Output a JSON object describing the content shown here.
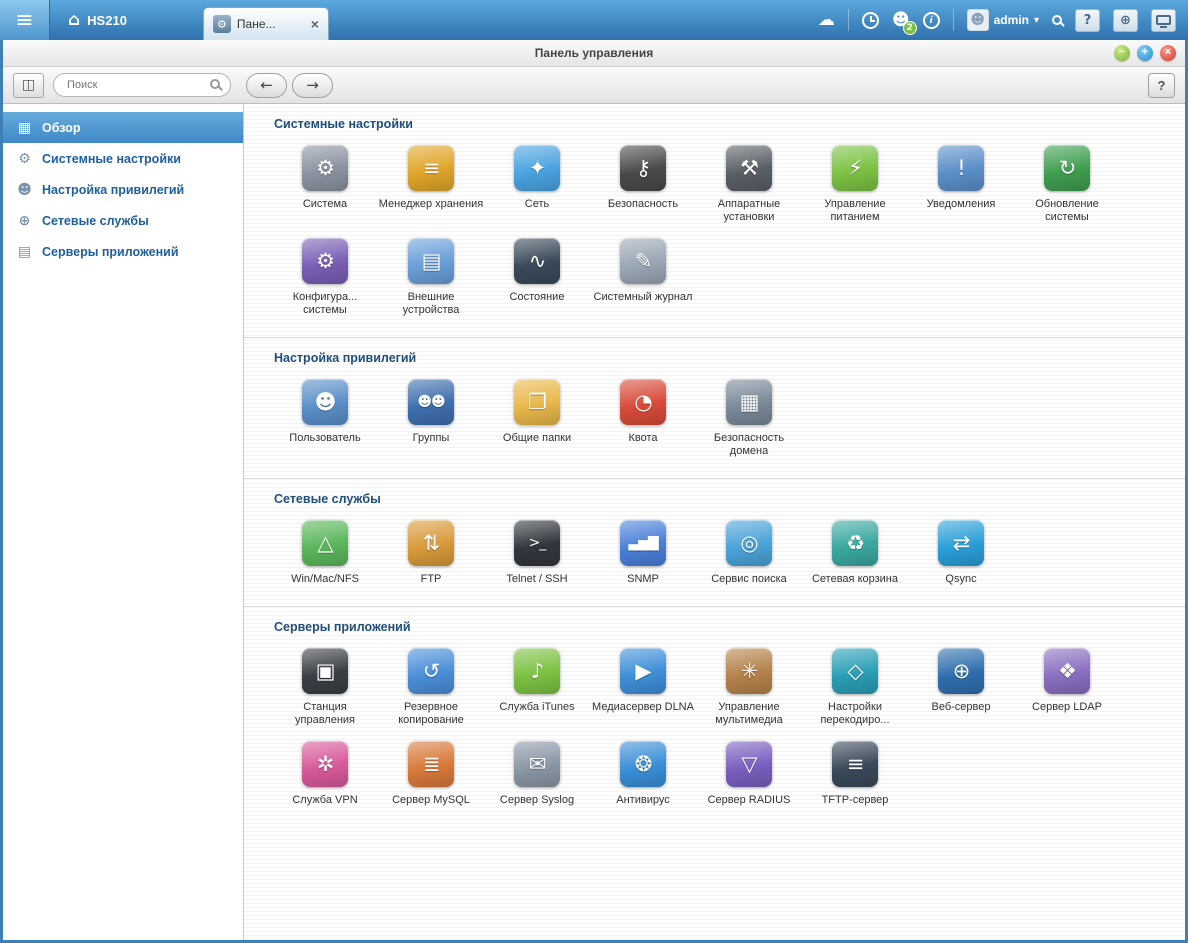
{
  "topbar": {
    "device_name": "HS210",
    "tab_label": "Пане...",
    "user_name": "admin",
    "task_badge": "2"
  },
  "window_title": "Панель управления",
  "window_controls": {
    "minimize": "−",
    "maximize": "+",
    "close": "×"
  },
  "toolbar": {
    "search_placeholder": "Поиск",
    "back_icon": "←",
    "forward_icon": "→",
    "help_label": "?"
  },
  "icons": {
    "menu": "≡",
    "home": "⌂",
    "tab_gear": "⚙",
    "tab_close": "×",
    "cloud": "☁",
    "info": "i",
    "user_silhouette": "☻",
    "caret_down": "▾",
    "sidebar_toggle": "◫",
    "globe": "⊕",
    "help": "?"
  },
  "colors": {
    "topbar_accent": "#3c86c4",
    "selected_item": "#4a94d4",
    "section_title": "#1f4e79"
  },
  "sidebar": {
    "items": [
      {
        "label": "Обзор",
        "icon": "overview-grid-icon",
        "glyph": "▦",
        "selected": true
      },
      {
        "label": "Системные настройки",
        "icon": "gear-icon",
        "glyph": "⚙",
        "selected": false
      },
      {
        "label": "Настройка привилегий",
        "icon": "user-icon",
        "glyph": "☻",
        "selected": false
      },
      {
        "label": "Сетевые службы",
        "icon": "globe-icon",
        "glyph": "⊕",
        "selected": false
      },
      {
        "label": "Серверы приложений",
        "icon": "server-icon",
        "glyph": "▤",
        "selected": false
      }
    ]
  },
  "sections": [
    {
      "title": "Системные настройки",
      "items": [
        {
          "label": "Система",
          "icon": "system-settings-icon",
          "glyph": "⚙",
          "color": "#8a93a0"
        },
        {
          "label": "Менеджер хранения",
          "icon": "storage-manager-icon",
          "glyph": "≡",
          "color": "#e0a62a"
        },
        {
          "label": "Сеть",
          "icon": "network-icon",
          "glyph": "✦",
          "color": "#4aa3e0"
        },
        {
          "label": "Безопасность",
          "icon": "security-lock-icon",
          "glyph": "⚷",
          "color": "#4a4a4a"
        },
        {
          "label": "Аппаратные установки",
          "icon": "hardware-icon",
          "glyph": "⚒",
          "color": "#5a5f66"
        },
        {
          "label": "Управление питанием",
          "icon": "power-icon",
          "glyph": "⚡",
          "color": "#7cc243"
        },
        {
          "label": "Уведомления",
          "icon": "notification-icon",
          "glyph": "!",
          "color": "#5b8fc9"
        },
        {
          "label": "Обновление системы",
          "icon": "firmware-update-icon",
          "glyph": "↻",
          "color": "#3f9e4f"
        },
        {
          "label": "Конфигура... системы",
          "icon": "system-config-icon",
          "glyph": "⚙",
          "color": "#7a5fb5"
        },
        {
          "label": "Внешние устройства",
          "icon": "external-device-icon",
          "glyph": "▤",
          "color": "#6a9fd8"
        },
        {
          "label": "Состояние",
          "icon": "system-status-icon",
          "glyph": "∿",
          "color": "#3a4a5a"
        },
        {
          "label": "Системный журнал",
          "icon": "system-logs-icon",
          "glyph": "✎",
          "color": "#9aa7b5"
        }
      ]
    },
    {
      "title": "Настройка привилегий",
      "items": [
        {
          "label": "Пользователь",
          "icon": "user-icon",
          "glyph": "☻",
          "color": "#5b8fc9"
        },
        {
          "label": "Группы",
          "icon": "user-group-icon",
          "glyph": "☻☻",
          "color": "#3f6fae"
        },
        {
          "label": "Общие папки",
          "icon": "shared-folder-icon",
          "glyph": "❐",
          "color": "#e8b84a"
        },
        {
          "label": "Квота",
          "icon": "quota-pie-icon",
          "glyph": "◔",
          "color": "#d84b3a"
        },
        {
          "label": "Безопасность домена",
          "icon": "domain-security-icon",
          "glyph": "▦",
          "color": "#7a8a99"
        }
      ]
    },
    {
      "title": "Сетевые службы",
      "items": [
        {
          "label": "Win/Mac/NFS",
          "icon": "win-mac-nfs-icon",
          "glyph": "△",
          "color": "#5bb75b"
        },
        {
          "label": "FTP",
          "icon": "ftp-icon",
          "glyph": "⇅",
          "color": "#d89a3a"
        },
        {
          "label": "Telnet / SSH",
          "icon": "terminal-icon",
          "glyph": ">_",
          "color": "#33373d"
        },
        {
          "label": "SNMP",
          "icon": "snmp-chart-icon",
          "glyph": "▃▅▇",
          "color": "#4a7fd8"
        },
        {
          "label": "Сервис поиска",
          "icon": "discovery-radar-icon",
          "glyph": "◎",
          "color": "#4aa3d8"
        },
        {
          "label": "Сетевая корзина",
          "icon": "network-recycle-bin-icon",
          "glyph": "♻",
          "color": "#3aa8a0"
        },
        {
          "label": "Qsync",
          "icon": "qsync-icon",
          "glyph": "⇄",
          "color": "#2a9fd8"
        }
      ]
    },
    {
      "title": "Серверы приложений",
      "items": [
        {
          "label": "Станция управления",
          "icon": "management-station-icon",
          "glyph": "▣",
          "color": "#3a3f45"
        },
        {
          "label": "Резервное копирование",
          "icon": "backup-icon",
          "glyph": "↺",
          "color": "#4a8fd8"
        },
        {
          "label": "Служба iTunes",
          "icon": "itunes-icon",
          "glyph": "♪",
          "color": "#7cc243"
        },
        {
          "label": "Медиасервер DLNA",
          "icon": "dlna-server-icon",
          "glyph": "▶",
          "color": "#3f8fd8"
        },
        {
          "label": "Управление мультимедиа",
          "icon": "multimedia-icon",
          "glyph": "✳",
          "color": "#b5824a"
        },
        {
          "label": "Настройки перекодиро...",
          "icon": "transcode-icon",
          "glyph": "◇",
          "color": "#2a9fb5"
        },
        {
          "label": "Веб-сервер",
          "icon": "web-server-icon",
          "glyph": "⊕",
          "color": "#2f6fae"
        },
        {
          "label": "Сервер LDAP",
          "icon": "ldap-server-icon",
          "glyph": "❖",
          "color": "#8a6fc0"
        },
        {
          "label": "Служба VPN",
          "icon": "vpn-service-icon",
          "glyph": "✲",
          "color": "#d85a9a"
        },
        {
          "label": "Сервер MySQL",
          "icon": "mysql-server-icon",
          "glyph": "≣",
          "color": "#d87a3a"
        },
        {
          "label": "Сервер Syslog",
          "icon": "syslog-server-icon",
          "glyph": "✉",
          "color": "#8a97a5"
        },
        {
          "label": "Антивирус",
          "icon": "antivirus-icon",
          "glyph": "❂",
          "color": "#3a8fd8"
        },
        {
          "label": "Сервер RADIUS",
          "icon": "radius-server-icon",
          "glyph": "▽",
          "color": "#7a5fc0"
        },
        {
          "label": "TFTP-сервер",
          "icon": "tftp-server-icon",
          "glyph": "≡",
          "color": "#3a4a5a"
        }
      ]
    }
  ]
}
